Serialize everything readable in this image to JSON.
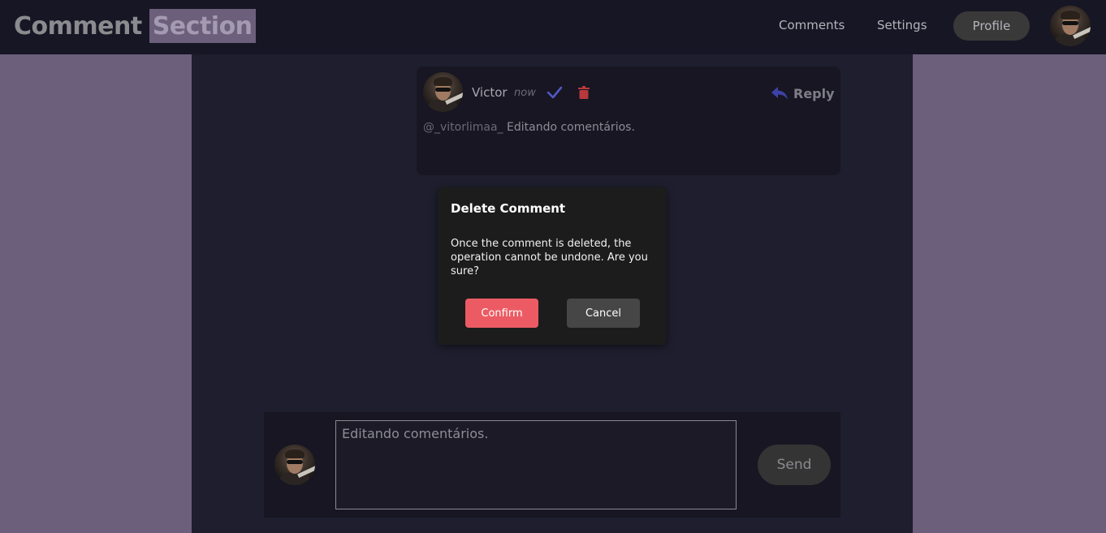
{
  "header": {
    "brand_part1": "Comment",
    "brand_part2": "Section",
    "nav": [
      "Comments",
      "Settings"
    ],
    "profile_label": "Profile"
  },
  "comment": {
    "author": "Victor",
    "time": "now",
    "reply_label": "Reply",
    "mention": "@_vitorlimaa_",
    "text": "Editando comentários."
  },
  "modal": {
    "title": "Delete Comment",
    "body": "Once the comment is deleted, the operation cannot be undone. Are you sure?",
    "confirm_label": "Confirm",
    "cancel_label": "Cancel"
  },
  "composer": {
    "value": "Editando comentários.",
    "send_label": "Send"
  },
  "colors": {
    "page_bg": "#6b5f7c",
    "main_bg": "#1e1e2e",
    "confirm": "#ec5b63",
    "check_icon": "#5158c4",
    "trash_icon": "#b8393c"
  }
}
